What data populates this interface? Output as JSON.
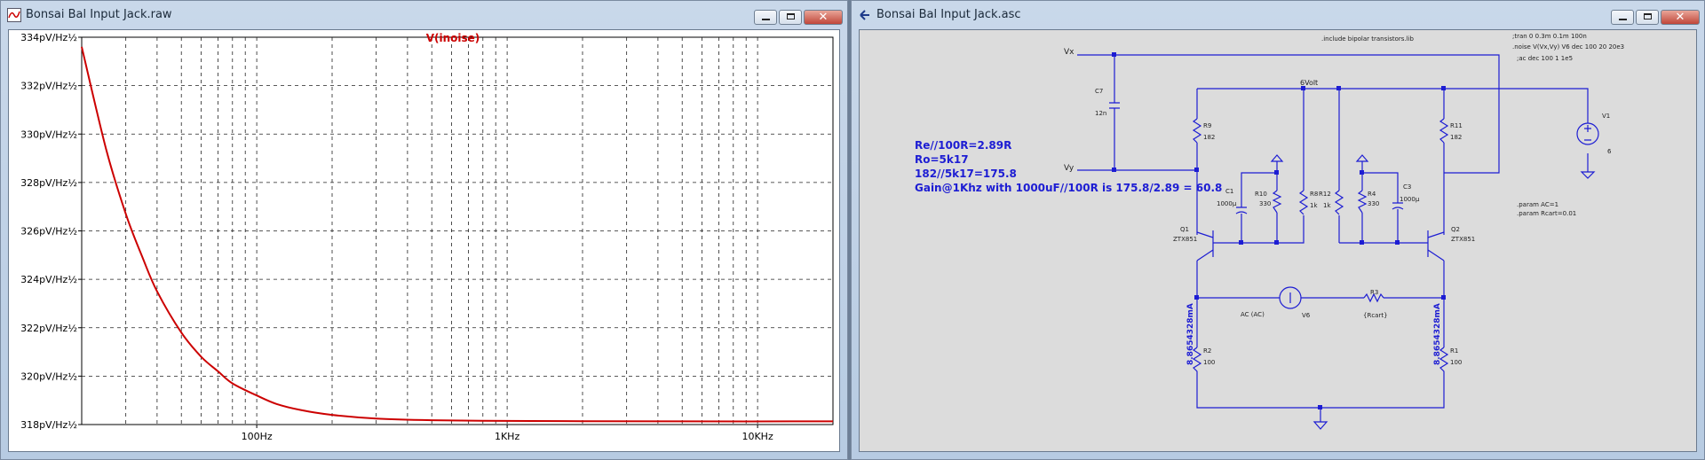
{
  "left_window": {
    "title": "Bonsai Bal Input Jack.raw",
    "trace_label": "V(inoise)",
    "trace_color": "#cc0000",
    "buttons": {
      "minimize": "minimize-icon",
      "maximize": "maximize-icon",
      "close": "✕"
    }
  },
  "right_window": {
    "title": "Bonsai Bal Input Jack.asc",
    "buttons": {
      "minimize": "minimize-icon",
      "maximize": "maximize-icon",
      "close": "✕"
    }
  },
  "chart_data": {
    "type": "line",
    "title": "V(inoise)",
    "x_scale": "log",
    "xlim": [
      20,
      20000
    ],
    "ylim": [
      318,
      334
    ],
    "y_unit": "pV/Hz½",
    "grid": true,
    "y_ticks": [
      {
        "value": 334,
        "label": "334pV/Hz½"
      },
      {
        "value": 332,
        "label": "332pV/Hz½"
      },
      {
        "value": 330,
        "label": "330pV/Hz½"
      },
      {
        "value": 328,
        "label": "328pV/Hz½"
      },
      {
        "value": 326,
        "label": "326pV/Hz½"
      },
      {
        "value": 324,
        "label": "324pV/Hz½"
      },
      {
        "value": 322,
        "label": "322pV/Hz½"
      },
      {
        "value": 320,
        "label": "320pV/Hz½"
      },
      {
        "value": 318,
        "label": "318pV/Hz½"
      }
    ],
    "x_ticks": [
      {
        "value": 100,
        "label": "100Hz"
      },
      {
        "value": 1000,
        "label": "1KHz"
      },
      {
        "value": 10000,
        "label": "10KHz"
      }
    ],
    "series": [
      {
        "color": "#cc0000",
        "x": [
          20,
          25,
          30,
          35,
          40,
          50,
          60,
          70,
          80,
          100,
          120,
          150,
          200,
          300,
          500,
          1000,
          2000,
          5000,
          20000
        ],
        "y": [
          333.6,
          329.4,
          326.7,
          324.9,
          323.5,
          321.8,
          320.8,
          320.2,
          319.7,
          319.2,
          318.85,
          318.6,
          318.4,
          318.25,
          318.18,
          318.15,
          318.14,
          318.13,
          318.13
        ]
      }
    ]
  },
  "schematic": {
    "directives": {
      "include": ".include bipolar transistors.lib",
      "tran": ";tran 0 0.3m 0.1m 100n",
      "noise": ".noise V(Vx,Vy) V6 dec 100 20 20e3",
      "ac": ";ac dec 100 1 1e5",
      "param_ac": ".param AC=1",
      "param_rcart": ".param Rcart=0.01"
    },
    "notes": [
      "Re//100R=2.89R",
      "Ro=5k17",
      "182//5k17=175.8",
      "Gain@1Khz  with 1000uF//100R is 175.8/2.89 = 60.8"
    ],
    "nets": {
      "vx": "Vx",
      "vy": "Vy",
      "supply": "6Volt"
    },
    "components": {
      "c7": {
        "name": "C7",
        "value": "12n"
      },
      "r9": {
        "name": "R9",
        "value": "182"
      },
      "r11": {
        "name": "R11",
        "value": "182"
      },
      "c1": {
        "name": "C1",
        "value": "1000µ"
      },
      "r10": {
        "name": "R10",
        "value": "330"
      },
      "r8": {
        "name": "R8",
        "value": "1k"
      },
      "r12": {
        "name": "R12",
        "value": "1k"
      },
      "r4": {
        "name": "R4",
        "value": "330"
      },
      "c3": {
        "name": "C3",
        "value": "1000µ"
      },
      "q1": {
        "name": "Q1",
        "value": "ZTX851"
      },
      "q2": {
        "name": "Q2",
        "value": "ZTX851"
      },
      "v6": {
        "name": "V6",
        "value": "AC (AC)"
      },
      "r3": {
        "name": "R3",
        "value": "{Rcart}"
      },
      "r2": {
        "name": "R2",
        "value": "100"
      },
      "r1": {
        "name": "R1",
        "value": "100"
      },
      "v1": {
        "name": "V1",
        "value": "6"
      }
    },
    "currents": {
      "left": "8.8654328mA",
      "right": "8.8654328mA"
    }
  }
}
